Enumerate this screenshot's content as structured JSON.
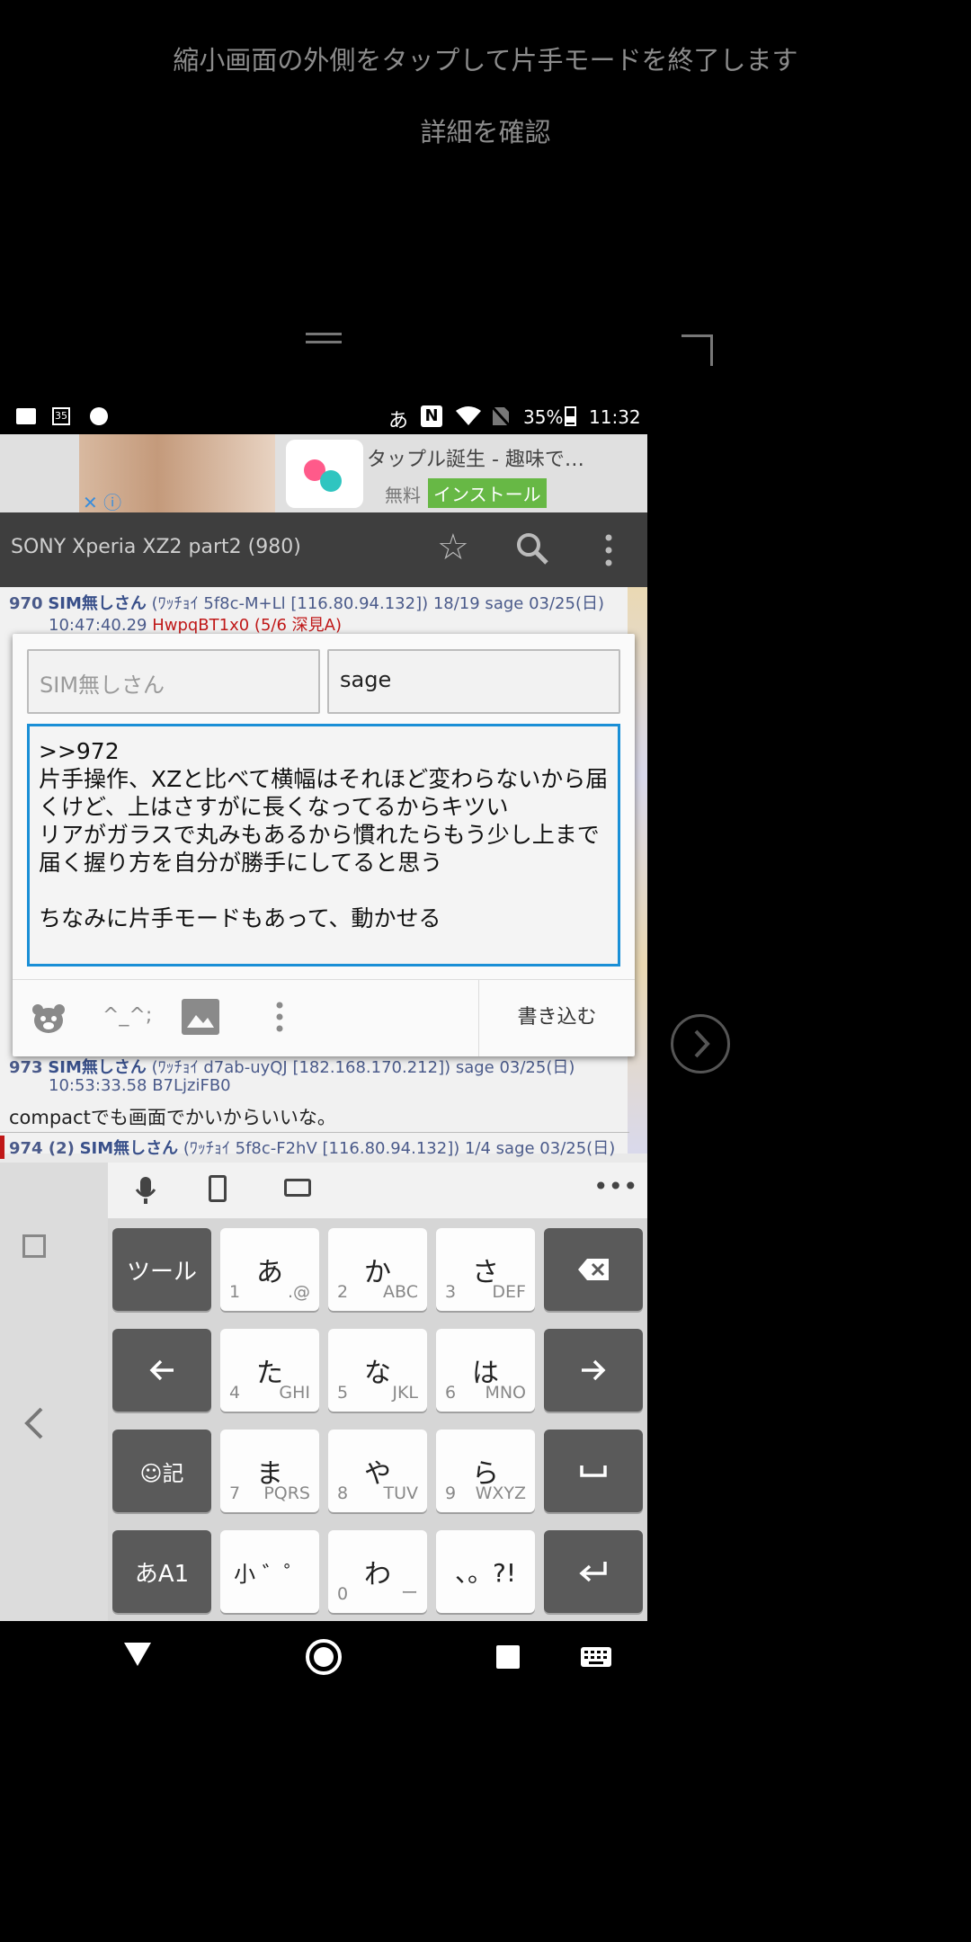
{
  "hint": {
    "message": "縮小画面の外側をタップして片手モードを終了します",
    "details_link": "詳細を確認"
  },
  "status_bar": {
    "ime": "あ",
    "battery": "35%",
    "time": "11:32"
  },
  "ad": {
    "title": "タップル誕生 - 趣味で…",
    "price": "無料",
    "install": "インストール"
  },
  "toolbar": {
    "title": "SONY Xperia XZ2 part2 (980)"
  },
  "posts": [
    {
      "num": "970",
      "name": "SIM無しさん",
      "meta": "(ﾜｯﾁｮｲ 5f8c-M+Ll [116.80.94.132]) 18/19 sage 03/25(日)",
      "time": "10:47:40.29",
      "id": "HwpqBT1x0 (5/6 深見A)"
    },
    {
      "num": "973",
      "name": "SIM無しさん",
      "meta": "(ﾜｯﾁｮｲ d7ab-uyQJ [182.168.170.212]) sage 03/25(日)",
      "time": "10:53:33.58 B7LjziFB0",
      "body": "compactでも画面でかいからいいな。"
    },
    {
      "num": "974 (2)",
      "name": "SIM無しさん",
      "meta": "(ﾜｯﾁｮｲ 5f8c-F2hV [116.80.94.132]) 1/4 sage 03/25(日)"
    }
  ],
  "compose": {
    "name_placeholder": "SIM無しさん",
    "mail_value": "sage",
    "body_value": ">>972\n片手操作、XZと比べて横幅はそれほど変わらないから届くけど、上はさすがに長くなってるからキツい\nリアがガラスで丸みもあるから慣れたらもう少し上まで届く握り方を自分が勝手にしてると思う\n\nちなみに片手モードもあって、動かせる",
    "kaomoji": "^_^;",
    "submit_label": "書き込む"
  },
  "keyboard": {
    "tool_label": "ツール",
    "keys": [
      {
        "main": "あ",
        "num": "1",
        "letters": ".@"
      },
      {
        "main": "か",
        "num": "2",
        "letters": "ABC"
      },
      {
        "main": "さ",
        "num": "3",
        "letters": "DEF"
      },
      {
        "main": "た",
        "num": "4",
        "letters": "GHI"
      },
      {
        "main": "な",
        "num": "5",
        "letters": "JKL"
      },
      {
        "main": "は",
        "num": "6",
        "letters": "MNO"
      },
      {
        "main": "ま",
        "num": "7",
        "letters": "PQRS"
      },
      {
        "main": "や",
        "num": "8",
        "letters": "TUV"
      },
      {
        "main": "ら",
        "num": "9",
        "letters": "WXYZ"
      },
      {
        "main": "わ",
        "num": "0",
        "letters": "ー"
      }
    ],
    "emoji_label": "☺記",
    "mode_label": "あA1",
    "small_label": "小 ゛゜",
    "punct_label": "、。?!"
  }
}
